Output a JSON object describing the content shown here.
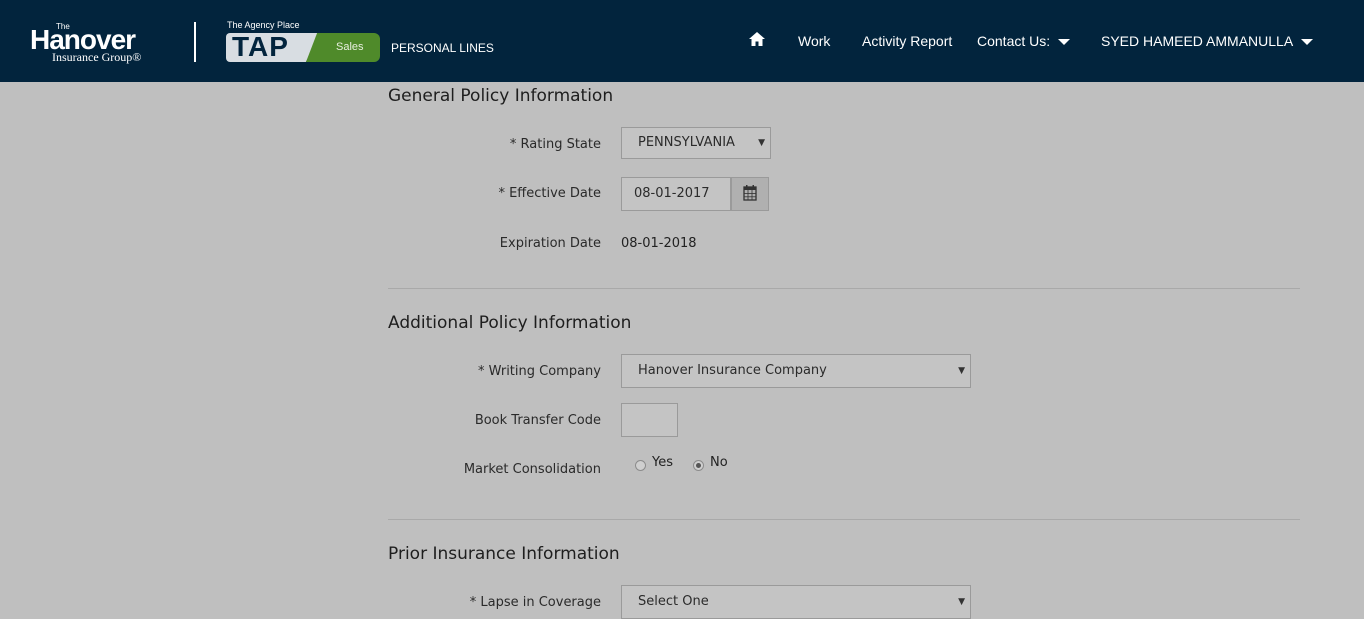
{
  "header": {
    "logo": {
      "the": "The",
      "name": "Hanover",
      "sub": "Insurance Group®"
    },
    "tap": {
      "tagline": "The Agency Place",
      "name": "TAP",
      "badge": "Sales"
    },
    "product": "PERSONAL LINES",
    "nav": {
      "home_icon": "home-icon",
      "work": "Work",
      "activity_report": "Activity Report",
      "contact_us": "Contact Us:",
      "user": "SYED HAMEED AMMANULLA"
    }
  },
  "general": {
    "title": "General Policy Information",
    "rating_state": {
      "label": "* Rating State",
      "value": "PENNSYLVANIA"
    },
    "effective_date": {
      "label": "* Effective Date",
      "value": "08-01-2017",
      "icon": "calendar-icon"
    },
    "expiration_date": {
      "label": "Expiration Date",
      "value": "08-01-2018"
    }
  },
  "additional": {
    "title": "Additional Policy Information",
    "writing_company": {
      "label": "* Writing Company",
      "value": "Hanover Insurance Company"
    },
    "book_transfer_code": {
      "label": "Book Transfer Code",
      "value": ""
    },
    "market_consolidation": {
      "label": "Market Consolidation",
      "yes": "Yes",
      "no": "No",
      "selected": "No"
    }
  },
  "prior": {
    "title": "Prior Insurance Information",
    "lapse": {
      "label": "* Lapse in Coverage",
      "value": "Select One"
    }
  },
  "colors": {
    "topbar": "#02243d",
    "tap_green": "#4f8a2a",
    "background": "#bfbfbf"
  }
}
